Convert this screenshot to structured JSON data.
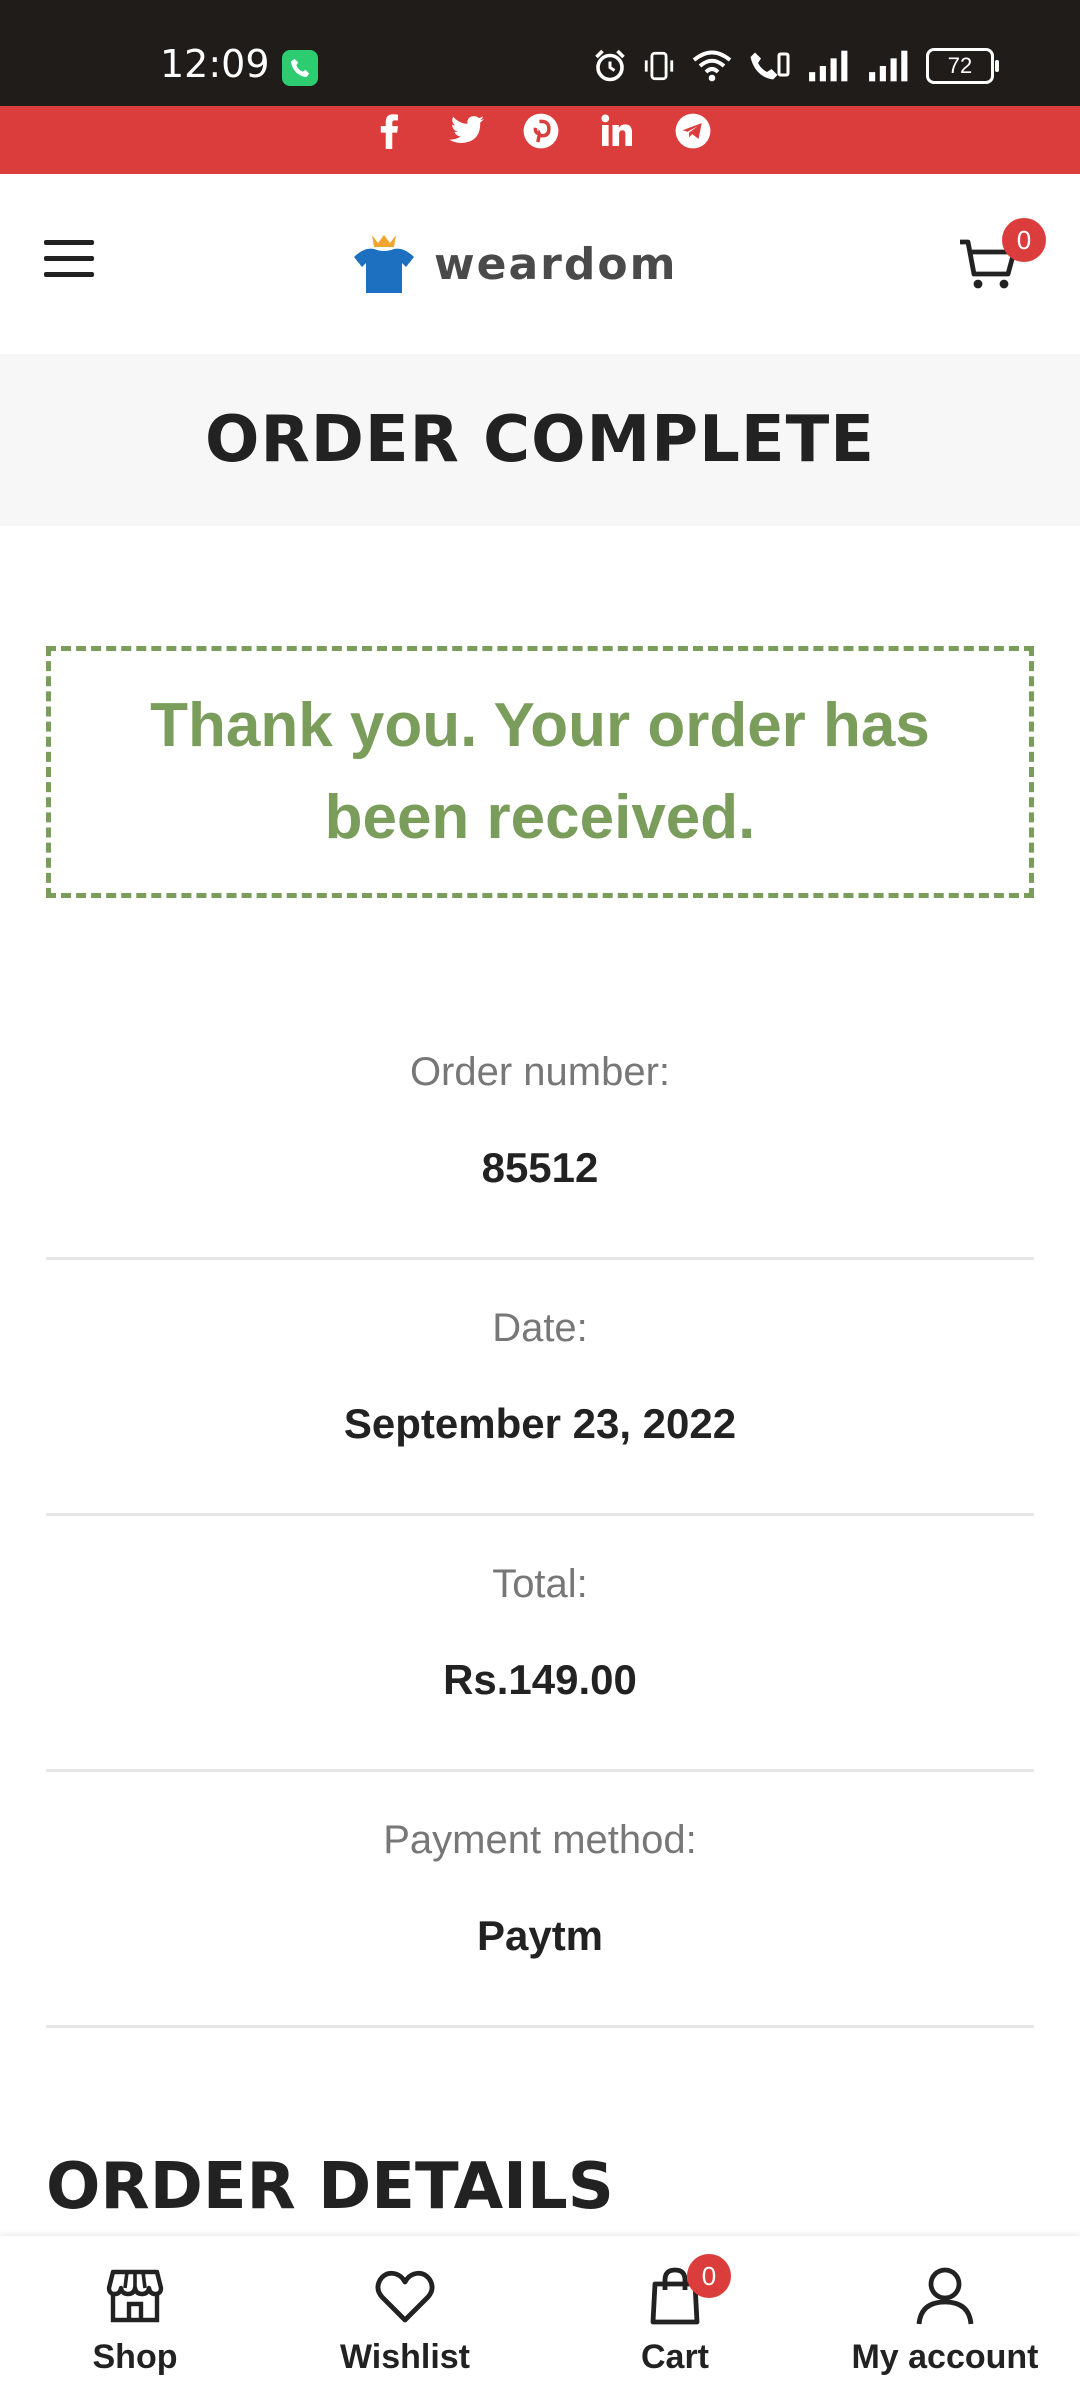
{
  "status_bar": {
    "time": "12:09",
    "battery": "72"
  },
  "header": {
    "brand": "weardom",
    "cart_count": "0"
  },
  "page": {
    "title": "ORDER COMPLETE",
    "notice": "Thank you. Your order has been received."
  },
  "overview": [
    {
      "label": "Order number:",
      "value": "85512"
    },
    {
      "label": "Date:",
      "value": "September 23, 2022"
    },
    {
      "label": "Total:",
      "value": "Rs.149.00"
    },
    {
      "label": "Payment method:",
      "value": "Paytm"
    }
  ],
  "details_title": "ORDER DETAILS",
  "bottom_nav": {
    "shop": "Shop",
    "wishlist": "Wishlist",
    "cart": "Cart",
    "cart_count": "0",
    "account": "My account"
  },
  "colors": {
    "accent_red": "#db3c3c",
    "success_green": "#7a9d5b",
    "status_bar_bg": "#1f1c1a"
  },
  "icons": [
    "phone-icon",
    "alarm-icon",
    "vibrate-icon",
    "wifi-icon",
    "call-signal-icon",
    "signal-icon",
    "battery-icon",
    "facebook-icon",
    "twitter-icon",
    "pinterest-icon",
    "linkedin-icon",
    "telegram-icon",
    "hamburger-menu-icon",
    "logo-shirt-icon",
    "cart-icon",
    "shop-icon",
    "heart-icon",
    "shopping-bag-icon",
    "user-icon"
  ]
}
